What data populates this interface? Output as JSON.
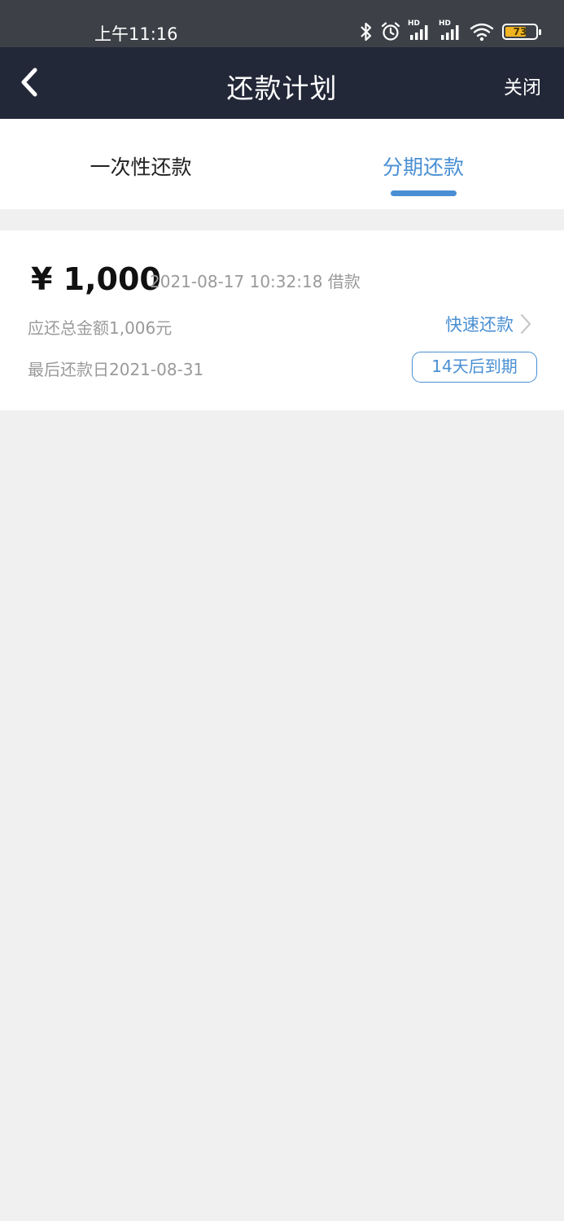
{
  "status_bar": {
    "time": "上午11:16",
    "signal_label_1": "HD",
    "signal_label_2": "HD",
    "battery_level": "73",
    "battery_fraction": 0.73,
    "battery_color": "#f0b323",
    "icons": [
      "bluetooth-icon",
      "alarm-icon",
      "signal-icon",
      "signal-icon",
      "wifi-icon",
      "battery-icon"
    ]
  },
  "nav": {
    "back_icon": "chevron-left-icon",
    "title": "还款计划",
    "close_label": "关闭"
  },
  "tabs": [
    {
      "label": "一次性还款",
      "active": false
    },
    {
      "label": "分期还款",
      "active": true
    }
  ],
  "loan": {
    "amount": "¥ 1,000",
    "meta": "2021-08-17 10:32:18 借款",
    "total_due": "应还总金额1,006元",
    "quick_repay_label": "快速还款",
    "last_day": "最后还款日2021-08-31",
    "due_badge": "14天后到期"
  },
  "colors": {
    "accent": "#4a8fd3",
    "nav_bg": "#232838",
    "status_bg": "#3d4147",
    "page_bg": "#f0f0f0"
  }
}
